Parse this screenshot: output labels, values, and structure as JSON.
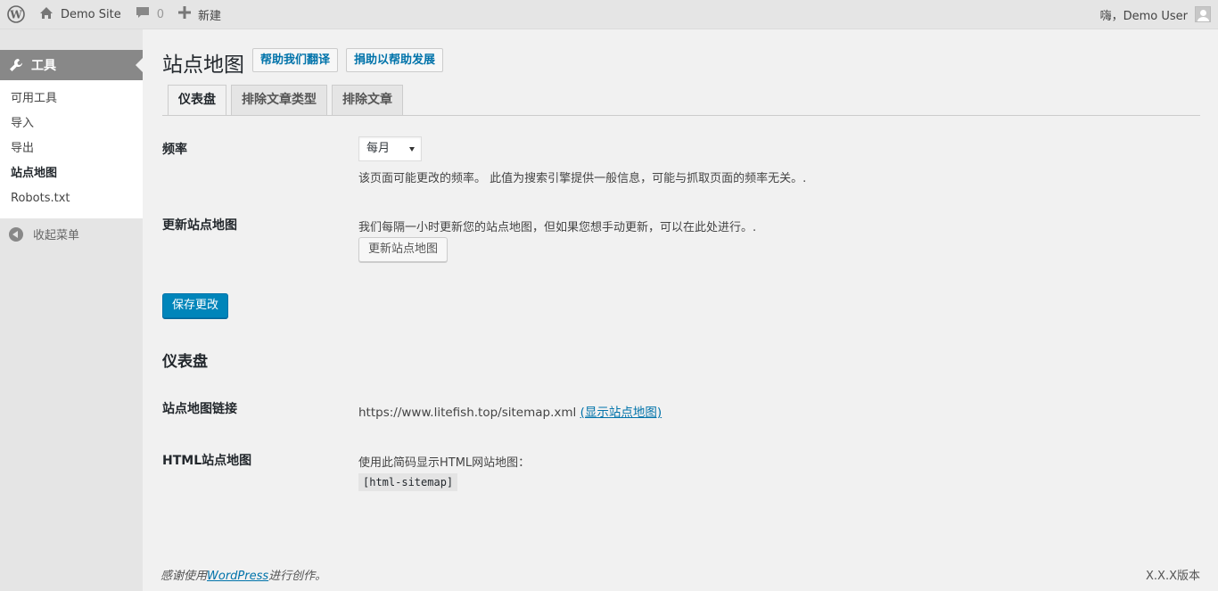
{
  "adminbar": {
    "site_name": "Demo Site",
    "comments_count": "0",
    "new_label": "新建",
    "greeting": "嗨，Demo User"
  },
  "sidebar": {
    "menu_title": "工具",
    "items": [
      {
        "label": "可用工具"
      },
      {
        "label": "导入"
      },
      {
        "label": "导出"
      },
      {
        "label": "站点地图"
      },
      {
        "label": "Robots.txt"
      }
    ],
    "collapse_label": "收起菜单"
  },
  "page": {
    "title": "站点地图",
    "help_translate": "帮助我们翻译",
    "donate": "捐助以帮助发展",
    "tabs": [
      {
        "label": "仪表盘"
      },
      {
        "label": "排除文章类型"
      },
      {
        "label": "排除文章"
      }
    ]
  },
  "settings": {
    "frequency_label": "频率",
    "frequency_value": "每月",
    "frequency_desc": "该页面可能更改的频率。 此值为搜索引擎提供一般信息，可能与抓取页面的频率无关。.",
    "update_label": "更新站点地图",
    "update_desc": "我们每隔一小时更新您的站点地图，但如果您想手动更新，可以在此处进行。.",
    "update_button": "更新站点地图",
    "save_button": "保存更改"
  },
  "dashboard": {
    "heading": "仪表盘",
    "sitemap_link_label": "站点地图链接",
    "sitemap_url": "https://www.litefish.top/sitemap.xml",
    "show_sitemap": "(显示站点地图)",
    "html_sitemap_label": "HTML站点地图",
    "html_sitemap_desc": "使用此简码显示HTML网站地图：",
    "shortcode": "[html-sitemap]"
  },
  "footer": {
    "thanks_prefix": "感谢使用",
    "wordpress": "WordPress",
    "thanks_suffix": "进行创作。",
    "version": "X.X.X版本"
  }
}
